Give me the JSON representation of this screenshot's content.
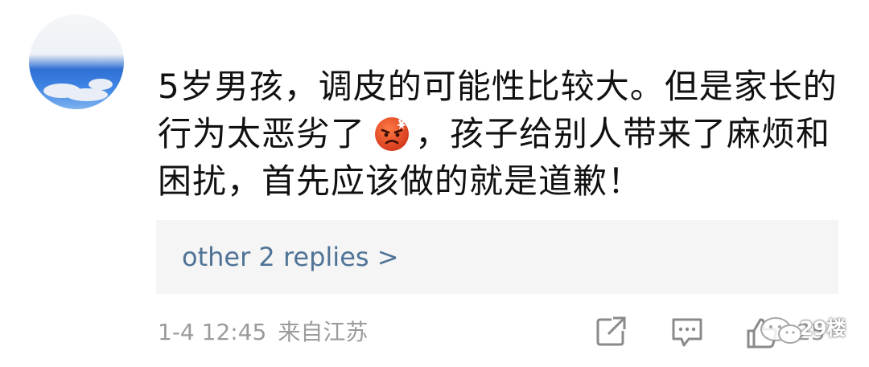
{
  "comment": {
    "text_part1": "5岁男孩，调皮的可能性比较大。但是家长的行为太恶劣了",
    "emoji": "angry-face-emoji",
    "text_part2": "，孩子给别人带来了麻烦和困扰，首先应该做的就是道歉！"
  },
  "replies": {
    "label": "other 2 replies >"
  },
  "meta": {
    "time": "1-4 12:45",
    "location": "来自江苏"
  },
  "actions": {
    "share_icon": "share-icon",
    "comment_icon": "comment-icon",
    "like_icon": "thumbs-up-icon",
    "like_count": "25"
  },
  "watermark": {
    "text": "29楼"
  },
  "colors": {
    "text": "#111111",
    "reply_link": "#4f7396",
    "reply_bg": "#f5f5f5",
    "meta": "#9b9b9b",
    "emoji": "#e8502c"
  }
}
